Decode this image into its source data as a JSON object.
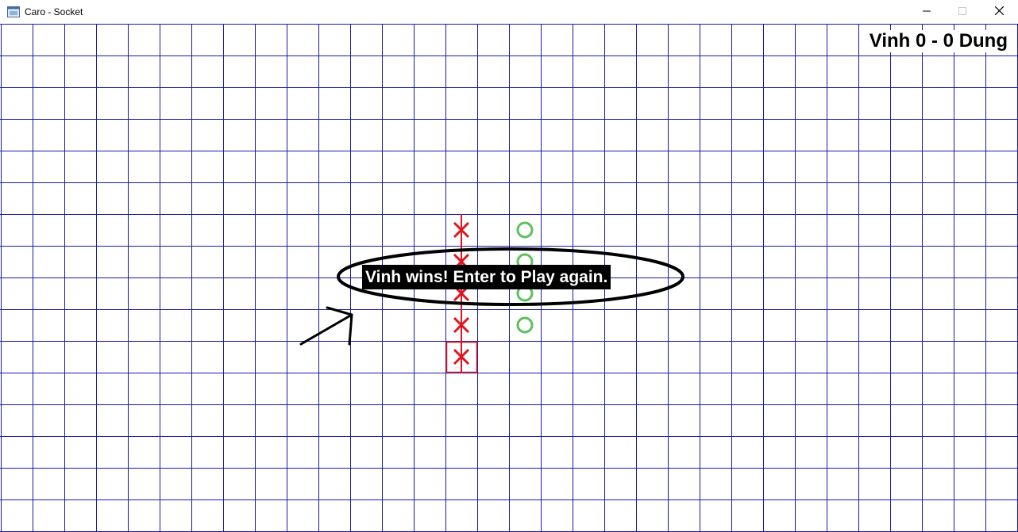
{
  "window": {
    "title": "Caro - Socket",
    "app_icon": "window-app-icon",
    "controls": {
      "minimize_icon": "minimize-icon",
      "maximize_icon": "maximize-icon",
      "close_icon": "close-icon"
    }
  },
  "scoreboard": {
    "text": "Vinh 0 - 0 Dung"
  },
  "message": {
    "text": "Vinh wins! Enter to Play again."
  },
  "board": {
    "grid_color": "#1a1aa8",
    "x_color": "#e0141e",
    "o_color": "#5cc05c",
    "win_line_color": "#e0141e",
    "moves": [
      {
        "mark": "X",
        "col": 14,
        "row": 6
      },
      {
        "mark": "X",
        "col": 14,
        "row": 7
      },
      {
        "mark": "X",
        "col": 14,
        "row": 8
      },
      {
        "mark": "X",
        "col": 14,
        "row": 9
      },
      {
        "mark": "X",
        "col": 14,
        "row": 10,
        "last": true
      },
      {
        "mark": "O",
        "col": 16,
        "row": 6
      },
      {
        "mark": "O",
        "col": 16,
        "row": 7
      },
      {
        "mark": "O",
        "col": 16,
        "row": 8
      },
      {
        "mark": "O",
        "col": 16,
        "row": 9
      }
    ],
    "winning_line": {
      "col": 14,
      "row_from": 6,
      "row_to": 10
    }
  },
  "annotations": {
    "highlight_ellipse": "winning-message-ellipse",
    "arrow": "pointer-arrow"
  }
}
